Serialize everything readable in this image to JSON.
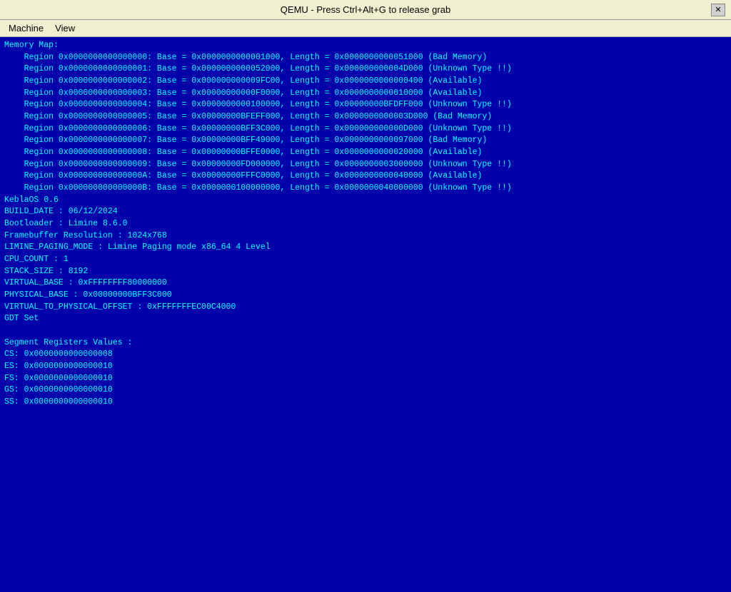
{
  "titlebar": {
    "title": "QEMU - Press Ctrl+Alt+G to release grab",
    "close_label": "✕"
  },
  "menubar": {
    "items": [
      "Machine",
      "View"
    ]
  },
  "content": {
    "lines": [
      "Memory Map:",
      "    Region 0x0000000000000000: Base = 0x0000000000001000, Length = 0x0000000000051000 (Bad Memory)",
      "    Region 0x0000000000000001: Base = 0x0000000000052000, Length = 0x000000000004D000 (Unknown Type !!)",
      "    Region 0x0000000000000002: Base = 0x000000000009FC00, Length = 0x0000000000000400 (Available)",
      "    Region 0x0000000000000003: Base = 0x00000000000F0000, Length = 0x0000000000010000 (Available)",
      "    Region 0x0000000000000004: Base = 0x0000000000100000, Length = 0x00000000BFDFF000 (Unknown Type !!)",
      "    Region 0x0000000000000005: Base = 0x00000000BFEFF000, Length = 0x0000000000003D000 (Bad Memory)",
      "    Region 0x0000000000000006: Base = 0x00000000BFF3C000, Length = 0x000000000000D000 (Unknown Type !!)",
      "    Region 0x0000000000000007: Base = 0x00000000BFF49000, Length = 0x0000000000097000 (Bad Memory)",
      "    Region 0x0000000000000008: Base = 0x00000000BFFE0000, Length = 0x0000000000020000 (Available)",
      "    Region 0x0000000000000009: Base = 0x00000000FD000000, Length = 0x0000000003000000 (Unknown Type !!)",
      "    Region 0x000000000000000A: Base = 0x00000000FFFC0000, Length = 0x0000000000040000 (Available)",
      "    Region 0x000000000000000B: Base = 0x0000000100000000, Length = 0x0000000040000000 (Unknown Type !!)",
      "KeblaOS 0.6",
      "BUILD_DATE : 06/12/2024",
      "Bootloader : Limine 8.6.0",
      "Framebuffer Resolution : 1024x768",
      "LIMINE_PAGING_MODE : Limine Paging mode x86_64 4 Level",
      "CPU_COUNT : 1",
      "STACK_SIZE : 8192",
      "VIRTUAL_BASE : 0xFFFFFFFF80000000",
      "PHYSICAL_BASE : 0x00000000BFF3C000",
      "VIRTUAL_TO_PHYSICAL_OFFSET : 0xFFFFFFFEC00C4000",
      "GDT Set",
      "",
      "Segment Registers Values :",
      "CS: 0x0000000000000008",
      "ES: 0x0000000000000010",
      "FS: 0x0000000000000010",
      "GS: 0x0000000000000010",
      "SS: 0x0000000000000010"
    ]
  }
}
